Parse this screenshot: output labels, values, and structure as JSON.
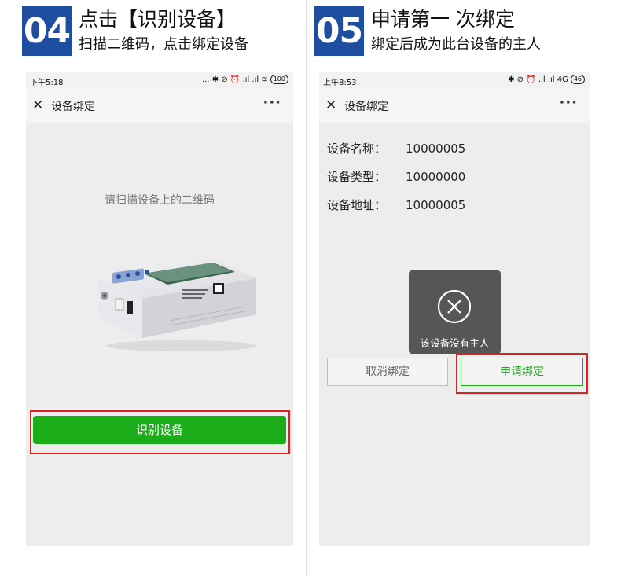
{
  "steps": [
    {
      "number": "04",
      "title": "点击【识别设备】",
      "subtitle": "扫描二维码，点击绑定设备"
    },
    {
      "number": "05",
      "title": "申请第一 次绑定",
      "subtitle": "绑定后成为此台设备的主人"
    }
  ],
  "phone_left": {
    "time": "下午5:18",
    "status_icons": "... ✱ ⊘ ⏰ .ıl .ıl ≋",
    "battery": "100",
    "nav_title": "设备绑定",
    "more": "···",
    "close": "✕",
    "hint": "请扫描设备上的二维码",
    "button_label": "识别设备",
    "device_label": "型号:RS-WS-N01-2\n规格:RS485温湿度变送器\n地址:01-0000\nNAM: 00001000"
  },
  "phone_right": {
    "time": "上午8:53",
    "status_icons": "✱ ⊘ ⏰ .ıl .ıl 4G",
    "battery": "46",
    "nav_title": "设备绑定",
    "more": "···",
    "close": "✕",
    "info": [
      {
        "key": "设备名称：",
        "value": "10000005"
      },
      {
        "key": "设备类型：",
        "value": "10000000"
      },
      {
        "key": "设备地址：",
        "value": "10000005"
      }
    ],
    "toast_text": "该设备没有主人",
    "toast_icon": "close-circle-icon",
    "cancel_label": "取消绑定",
    "apply_label": "申请绑定"
  },
  "colors": {
    "step_badge": "#1d4ea0",
    "wechat_green": "#1aad19",
    "highlight_red": "#e02020",
    "toast_bg": "#555656"
  }
}
